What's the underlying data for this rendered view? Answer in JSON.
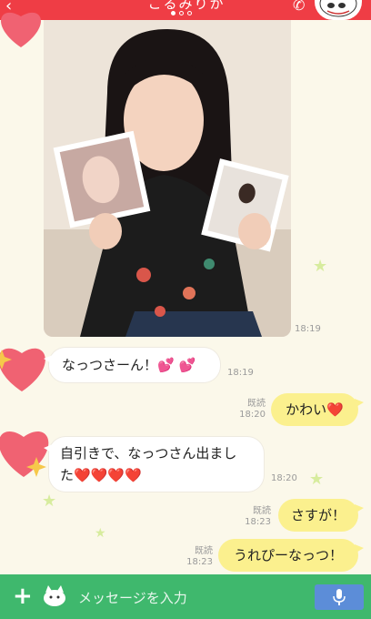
{
  "header": {
    "title": "こるみりか",
    "back_icon": "chevron-left-icon",
    "call_icon": "phone-icon",
    "page_dots": 3,
    "active_dot": 1
  },
  "messages": [
    {
      "id": "photo",
      "direction": "in",
      "type": "image",
      "time": "18:19"
    },
    {
      "id": "m1",
      "direction": "in",
      "text": "なっつさーん！",
      "emoji": "💕 💕",
      "time": "18:19"
    },
    {
      "id": "m2",
      "direction": "out",
      "text": "かわい",
      "emoji": "❤️",
      "read": "既読",
      "time": "18:20"
    },
    {
      "id": "m3",
      "direction": "in",
      "line1": "自引きで、なっつさん出まし",
      "line2": "た",
      "emoji": "❤️❤️❤️❤️",
      "time": "18:20"
    },
    {
      "id": "m4",
      "direction": "out",
      "text": "さすが！",
      "read": "既読",
      "time": "18:23"
    },
    {
      "id": "m5",
      "direction": "out",
      "text": "うれぴーなっつ！",
      "read": "既読",
      "time": "18:23"
    }
  ],
  "input_bar": {
    "placeholder": "メッセージを入力",
    "plus_icon": "plus-icon",
    "sticker_icon": "sticker-icon",
    "mic_icon": "microphone-icon"
  },
  "colors": {
    "header": "#ef3d45",
    "background": "#fbf8ea",
    "out_bubble": "#fbf08e",
    "in_bubble": "#ffffff",
    "input_bar": "#3fb86d",
    "mic_button": "#5c8dd8"
  }
}
